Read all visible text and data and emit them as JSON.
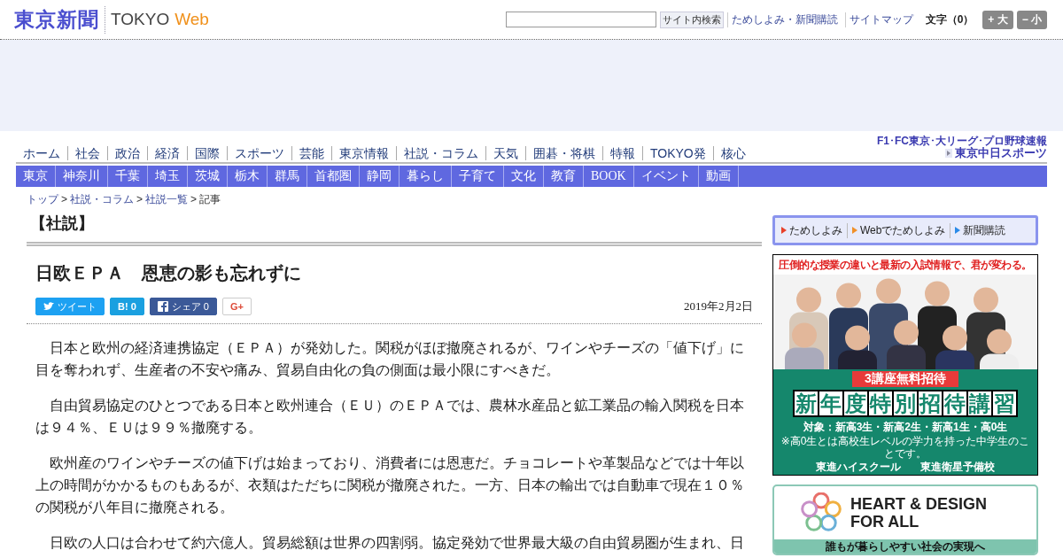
{
  "header": {
    "logo": "東京新聞",
    "logo_sub_1": "TOKYO",
    "logo_sub_2": "Web",
    "search": {
      "button": "サイト内検索"
    },
    "links": [
      "ためしよみ・新聞購読",
      "サイトマップ"
    ],
    "font_size_label": "文字（0）",
    "font_buttons": [
      "+ 大",
      "− 小"
    ]
  },
  "main_nav": [
    {
      "label": "ホーム"
    },
    {
      "label": "社会"
    },
    {
      "label": "政治"
    },
    {
      "label": "経済"
    },
    {
      "label": "国際"
    },
    {
      "label": "スポーツ"
    },
    {
      "label": "芸能"
    },
    {
      "label": "東京情報"
    },
    {
      "label": "社説・コラム"
    },
    {
      "label": "天気"
    },
    {
      "label": "囲碁・将棋"
    },
    {
      "label": "特報"
    },
    {
      "label": "TOKYO発"
    },
    {
      "label": "核心"
    }
  ],
  "sports_banner": {
    "line_1": "F1･FC東京･大リーグ･プロ野球速報",
    "line_2": "東京中日スポーツ"
  },
  "region_nav": [
    "東京",
    "神奈川",
    "千葉",
    "埼玉",
    "茨城",
    "栃木",
    "群馬",
    "首都圏",
    "静岡",
    "暮らし",
    "子育て",
    "文化",
    "教育",
    "BOOK",
    "イベント",
    "動画"
  ],
  "breadcrumb": [
    {
      "kind": "link",
      "label": "トップ"
    },
    {
      "kind": "separator",
      "label": ">"
    },
    {
      "kind": "link",
      "label": "社説・コラム"
    },
    {
      "kind": "separator",
      "label": ">"
    },
    {
      "kind": "link",
      "label": "社説一覧"
    },
    {
      "kind": "separator",
      "label": ">"
    },
    {
      "kind": "current",
      "label": "記事"
    }
  ],
  "section_title": "【社説】",
  "article": {
    "title": "日欧ＥＰＡ　恩恵の影も忘れずに",
    "share": [
      {
        "kind": "twitter",
        "label": "ツイート"
      },
      {
        "kind": "hatena",
        "label": "B!",
        "count": "0"
      },
      {
        "kind": "facebook",
        "label": "シェア",
        "count": "0"
      },
      {
        "kind": "google",
        "label": "G+"
      }
    ],
    "date": "2019年2月2日",
    "paragraphs": [
      "日本と欧州の経済連携協定（ＥＰＡ）が発効した。関税がほぼ撤廃されるが、ワインやチーズの「値下げ」に目を奪われず、生産者の不安や痛み、貿易自由化の負の側面は最小限にすべきだ。",
      "自由貿易協定のひとつである日本と欧州連合（ＥＵ）のＥＰＡでは、農林水産品と鉱工業品の輸入関税を日本は９４％、ＥＵは９９％撤廃する。",
      "欧州産のワインやチーズの値下げは始まっており、消費者には恩恵だ。チョコレートや革製品などでは十年以上の時間がかかるものもあるが、衣類はただちに関税が撤廃された。一方、日本の輸出では自動車で現在１０％の関税が八年目に撤廃される。",
      "日欧の人口は合わせて約六億人。貿易総額は世界の四割弱。協定発効で世界最大級の自由貿易圏が生まれ、日"
    ]
  },
  "sidebar": {
    "subscribe_tabs": [
      {
        "label": "ためしよみ",
        "color": "#e8402a"
      },
      {
        "label": "Webでためしよみ",
        "color": "#f0902a"
      },
      {
        "label": "新聞購読",
        "color": "#2a8ae8"
      }
    ],
    "school_ad": {
      "headline": "圧倒的な授業の違いと最新の入試情報で、君が変わる。",
      "badge": "3講座無料招待",
      "title_chars": [
        "新",
        "年",
        "度",
        "特",
        "別",
        "招",
        "待",
        "講",
        "習"
      ],
      "target": "対象：新高3生・新高2生・新高1生・高0生",
      "note": "※高0生とは高校生レベルの学力を持った中学生のことです。",
      "schools": [
        "東進ハイスクール",
        "東進衛星予備校"
      ]
    },
    "design_ad": {
      "title_1": "HEART & DESIGN",
      "title_2": "FOR ALL",
      "caption": "誰もが暮らしやすい社会の実現へ"
    }
  }
}
